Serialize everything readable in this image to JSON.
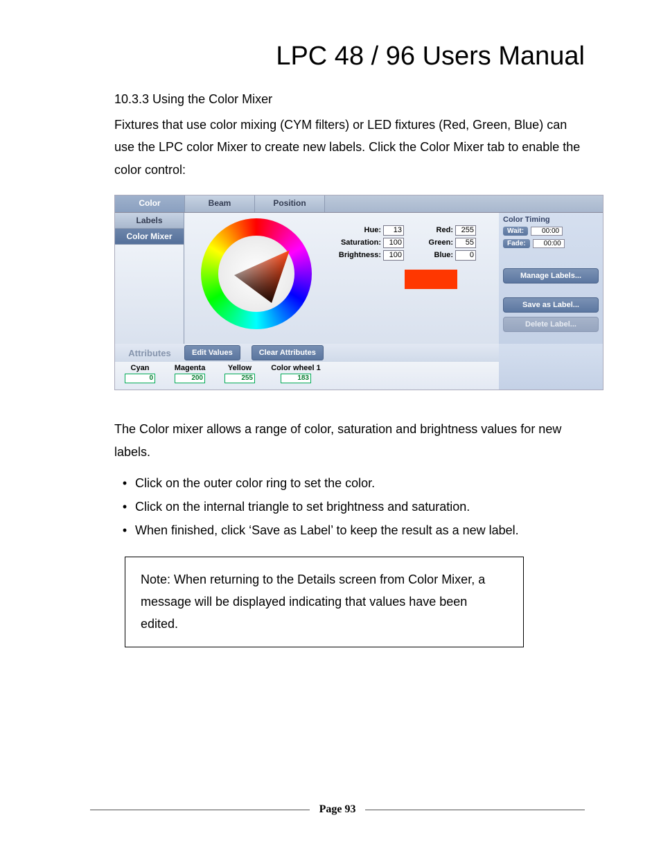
{
  "doc": {
    "title": "LPC 48 / 96 Users Manual",
    "section_heading": "10.3.3 Using the Color Mixer",
    "intro": "Fixtures that use color mixing (CYM filters) or LED fixtures (Red, Green, Blue) can use the LPC color Mixer to create new labels.  Click the Color Mixer tab to enable the color control:",
    "after": "The Color mixer allows a range of color, saturation and brightness values for new labels.",
    "bullets": [
      "Click on the outer color ring to set the color.",
      "Click on the internal triangle to set brightness and saturation.",
      "When finished, click ‘Save as Label’ to keep the result as a new label."
    ],
    "note": "Note:  When returning to the Details screen from Color Mixer, a message will be displayed indicating that values have been edited.",
    "page_label": "Page 93"
  },
  "ui": {
    "top_tabs": {
      "color": "Color",
      "beam": "Beam",
      "position": "Position"
    },
    "side_tabs": {
      "labels": "Labels",
      "colormixer": "Color Mixer"
    },
    "hsb": {
      "hue_label": "Hue:",
      "hue": "13",
      "sat_label": "Saturation:",
      "sat": "100",
      "bri_label": "Brightness:",
      "bri": "100"
    },
    "rgb": {
      "red_label": "Red:",
      "red": "255",
      "green_label": "Green:",
      "green": "55",
      "blue_label": "Blue:",
      "blue": "0"
    },
    "right": {
      "title": "Color Timing",
      "wait_label": "Wait:",
      "wait_val": "00:00",
      "fade_label": "Fade:",
      "fade_val": "00:00",
      "manage": "Manage Labels...",
      "save": "Save as Label...",
      "delete": "Delete Label..."
    },
    "bottom": {
      "attributes_label": "Attributes",
      "edit_values": "Edit Values",
      "clear_attrs": "Clear Attributes",
      "cols": {
        "cyan_label": "Cyan",
        "cyan": "0",
        "magenta_label": "Magenta",
        "magenta": "200",
        "yellow_label": "Yellow",
        "yellow": "255",
        "cw1_label": "Color wheel 1",
        "cw1": "183"
      }
    }
  }
}
